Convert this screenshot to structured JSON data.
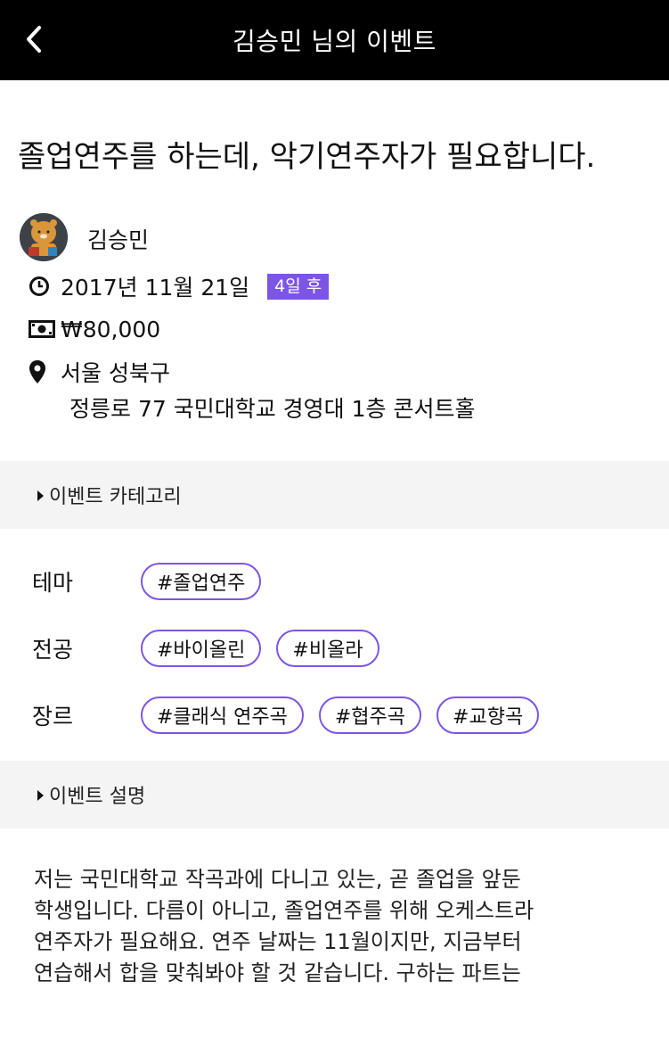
{
  "header": {
    "title": "김승민 님의 이벤트"
  },
  "event": {
    "title": "졸업연주를 하는데, 악기연주자가 필요합니다.",
    "host": "김승민",
    "date": "2017년 11월 21일",
    "date_badge": "4일 후",
    "price": "₩80,000",
    "location": "서울 성북구",
    "address": "정릉로 77 국민대학교 경영대 1층 콘서트홀"
  },
  "category_section": {
    "title": "이벤트 카테고리",
    "rows": [
      {
        "label": "테마",
        "tags": [
          "#졸업연주"
        ]
      },
      {
        "label": "전공",
        "tags": [
          "#바이올린",
          "#비올라"
        ]
      },
      {
        "label": "장르",
        "tags": [
          "#클래식 연주곡",
          "#협주곡",
          "#교향곡"
        ]
      }
    ]
  },
  "description_section": {
    "title": "이벤트 설명",
    "lines": [
      "저는 국민대학교 작곡과에 다니고 있는, 곧 졸업을 앞둔",
      "학생입니다. 다름이 아니고, 졸업연주를 위해 오케스트라",
      "연주자가 필요해요. 연주 날짜는 11월이지만, 지금부터",
      "연습해서 합을 맞춰봐야 할 것 같습니다. 구하는 파트는"
    ]
  },
  "colors": {
    "accent": "#7c55e6",
    "header_bg": "#000000",
    "section_bg": "#f4f4f4"
  },
  "icons": {
    "back": "chevron-left-icon",
    "date": "clock-icon",
    "price": "money-bill-icon",
    "location": "map-marker-icon",
    "section": "caret-right-icon"
  }
}
